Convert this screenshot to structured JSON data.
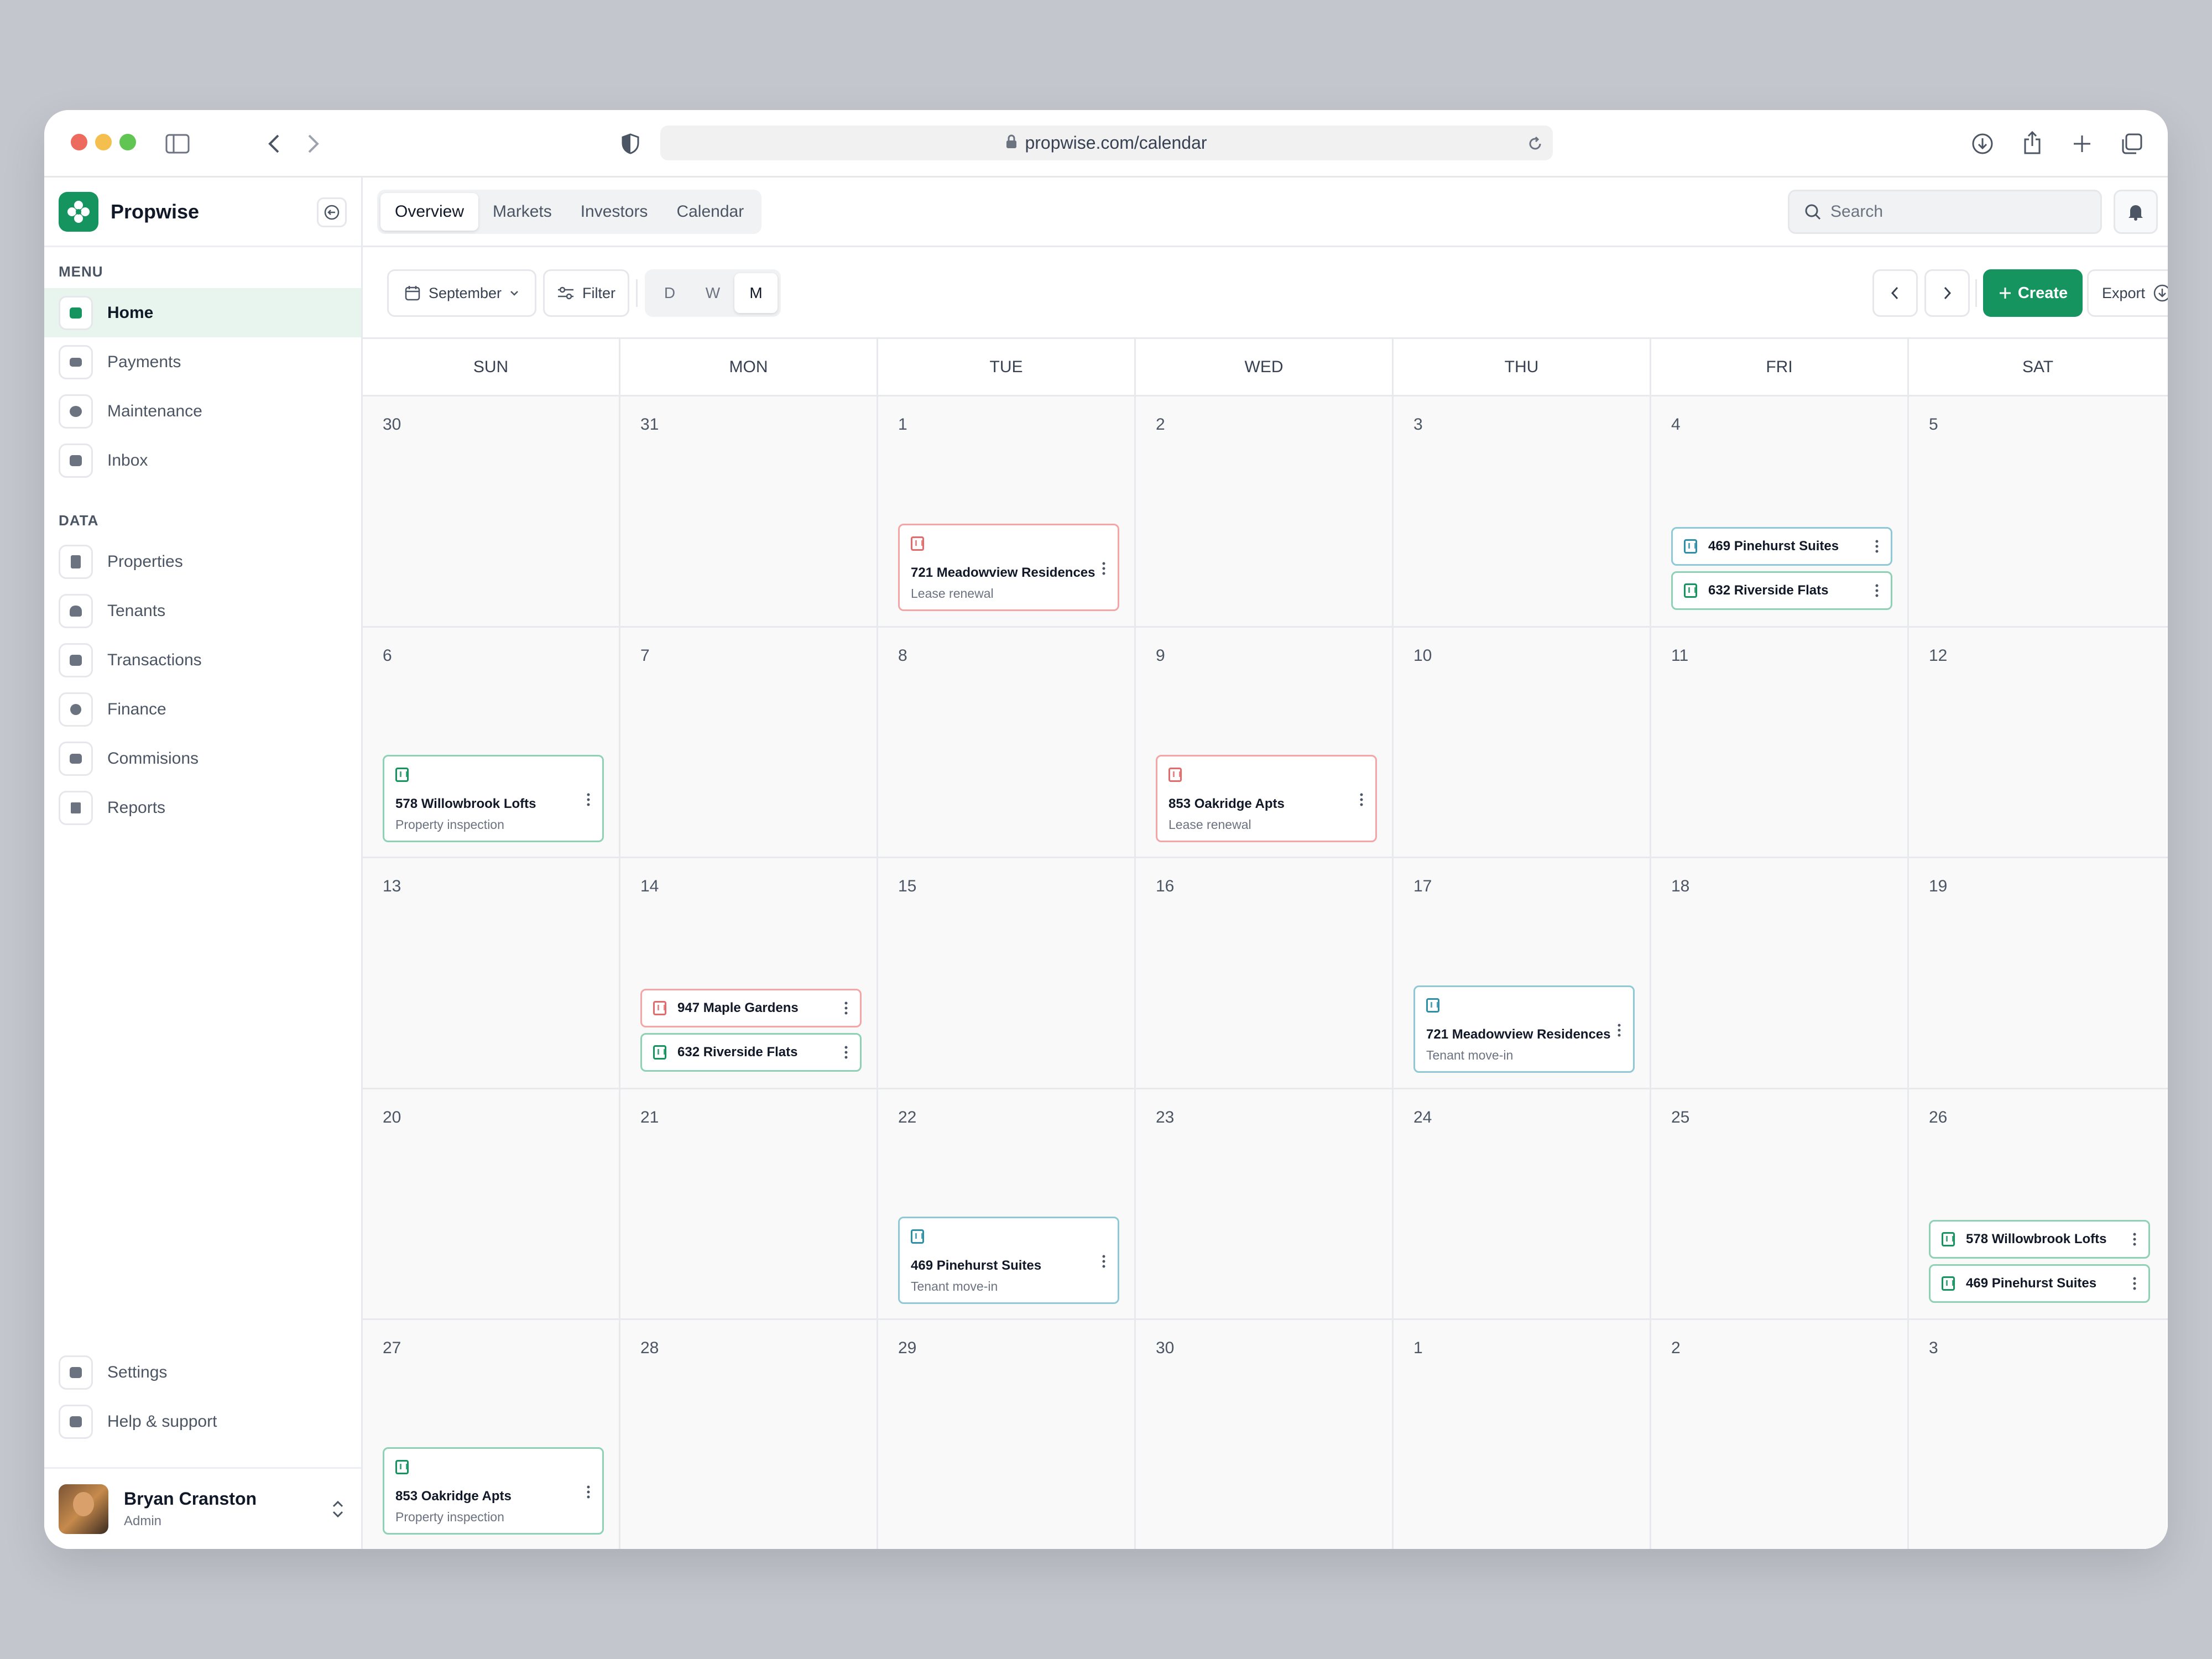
{
  "browser": {
    "url": "propwise.com/calendar"
  },
  "brand": {
    "name": "Propwise"
  },
  "sidebar": {
    "menu_label": "MENU",
    "data_label": "DATA",
    "menu_items": [
      {
        "label": "Home",
        "icon": "home-icon",
        "active": true
      },
      {
        "label": "Payments",
        "icon": "card-icon"
      },
      {
        "label": "Maintenance",
        "icon": "maintenance-icon"
      },
      {
        "label": "Inbox",
        "icon": "inbox-icon"
      }
    ],
    "data_items": [
      {
        "label": "Properties",
        "icon": "building-icon"
      },
      {
        "label": "Tenants",
        "icon": "users-icon"
      },
      {
        "label": "Transactions",
        "icon": "receipt-icon"
      },
      {
        "label": "Finance",
        "icon": "dollar-icon"
      },
      {
        "label": "Commisions",
        "icon": "wallet-icon"
      },
      {
        "label": "Reports",
        "icon": "bar-chart-icon"
      }
    ],
    "bottom_items": [
      {
        "label": "Settings",
        "icon": "settings-icon"
      },
      {
        "label": "Help & support",
        "icon": "help-icon"
      }
    ],
    "user": {
      "name": "Bryan Cranston",
      "role": "Admin"
    }
  },
  "header": {
    "tabs": [
      "Overview",
      "Markets",
      "Investors",
      "Calendar"
    ],
    "active_tab": "Overview",
    "search_placeholder": "Search"
  },
  "toolbar": {
    "month": "September",
    "filter_label": "Filter",
    "views": [
      "D",
      "W",
      "M"
    ],
    "active_view": "M",
    "create_label": "Create",
    "export_label": "Export"
  },
  "calendar": {
    "weekdays": [
      "SUN",
      "MON",
      "TUE",
      "WED",
      "THU",
      "FRI",
      "SAT"
    ],
    "weeks": [
      [
        "30",
        "31",
        "1",
        "2",
        "3",
        "4",
        "5"
      ],
      [
        "6",
        "7",
        "8",
        "9",
        "10",
        "11",
        "12"
      ],
      [
        "13",
        "14",
        "15",
        "16",
        "17",
        "18",
        "19"
      ],
      [
        "20",
        "21",
        "22",
        "23",
        "24",
        "25",
        "26"
      ],
      [
        "27",
        "28",
        "29",
        "30",
        "1",
        "2",
        "3"
      ]
    ],
    "colors": {
      "red": "#e46b6b",
      "green": "#16945f",
      "teal": "#2e8fa9"
    },
    "events": [
      {
        "week": 0,
        "day": 2,
        "title": "721 Meadowview Residences",
        "subtitle": "Lease renewal",
        "color": "red"
      },
      {
        "week": 0,
        "day": 5,
        "title": "469 Pinehurst Suites",
        "color": "teal"
      },
      {
        "week": 0,
        "day": 5,
        "title": "632 Riverside Flats",
        "color": "green"
      },
      {
        "week": 1,
        "day": 0,
        "title": "578 Willowbrook Lofts",
        "subtitle": "Property inspection",
        "color": "green"
      },
      {
        "week": 1,
        "day": 3,
        "title": "853 Oakridge Apts",
        "subtitle": "Lease renewal",
        "color": "red"
      },
      {
        "week": 2,
        "day": 1,
        "title": "947 Maple Gardens",
        "color": "red"
      },
      {
        "week": 2,
        "day": 1,
        "title": "632 Riverside Flats",
        "color": "green"
      },
      {
        "week": 2,
        "day": 4,
        "title": "721 Meadowview Residences",
        "subtitle": "Tenant move-in",
        "color": "teal"
      },
      {
        "week": 3,
        "day": 2,
        "title": "469 Pinehurst Suites",
        "subtitle": "Tenant move-in",
        "color": "teal"
      },
      {
        "week": 3,
        "day": 6,
        "title": "578 Willowbrook Lofts",
        "color": "green"
      },
      {
        "week": 3,
        "day": 6,
        "title": "469 Pinehurst Suites",
        "color": "green"
      },
      {
        "week": 4,
        "day": 0,
        "title": "853 Oakridge Apts",
        "subtitle": "Property inspection",
        "color": "green"
      }
    ]
  }
}
